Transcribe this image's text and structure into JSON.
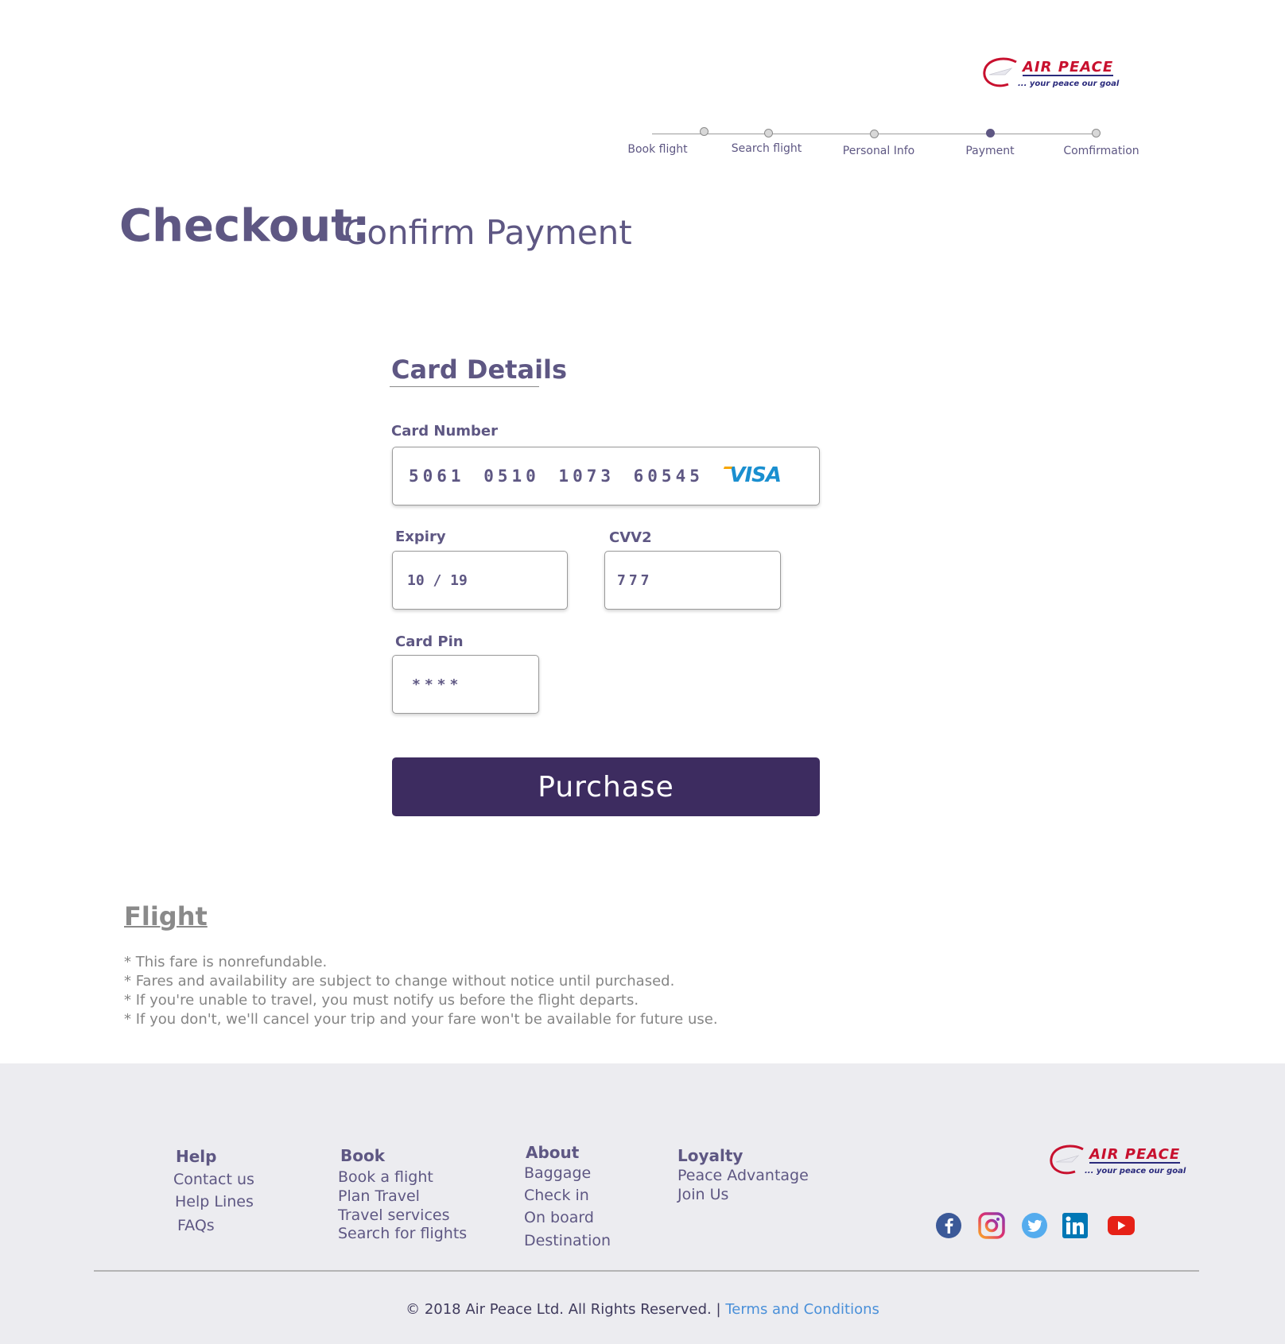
{
  "brand": {
    "name": "AIR PEACE",
    "tagline": "... your peace our goal",
    "colors": {
      "red": "#c8102e",
      "navy": "#2a2a7c",
      "purple": "#5e5783",
      "button": "#3d2c60",
      "link": "#4a90d9"
    }
  },
  "progress": {
    "steps": [
      {
        "label": "Book flight",
        "active": false
      },
      {
        "label": "Search flight",
        "active": false
      },
      {
        "label": "Personal Info",
        "active": false
      },
      {
        "label": "Payment",
        "active": true
      },
      {
        "label": "Comfirmation",
        "active": false
      }
    ]
  },
  "heading": {
    "title": "Checkout:",
    "subtitle": "Confirm Payment"
  },
  "card": {
    "section_title": "Card Details",
    "number_label": "Card Number",
    "number_value": "5061 0510 1073 60545",
    "card_brand": "VISA",
    "expiry_label": "Expiry",
    "expiry_value": "10 / 19",
    "cvv_label": "CVV2",
    "cvv_value": "777",
    "pin_label": "Card Pin",
    "pin_value": "****",
    "purchase_label": "Purchase"
  },
  "flight": {
    "title": "Flight",
    "notes": [
      "* This fare is nonrefundable.",
      "* Fares and availability are subject to change without notice until purchased.",
      "* If you're unable to travel, you must notify us before the flight departs.",
      "* If you don't, we'll cancel your trip and your fare won't be available for future use."
    ]
  },
  "footer": {
    "help": {
      "title": "Help",
      "links": [
        "Contact us",
        "Help Lines",
        "FAQs"
      ]
    },
    "book": {
      "title": "Book",
      "links": [
        "Book a flight",
        "Plan Travel",
        "Travel services",
        "Search for flights"
      ]
    },
    "about": {
      "title": "About",
      "links": [
        "Baggage",
        "Check in",
        "On board",
        "Destination"
      ]
    },
    "loyalty": {
      "title": "Loyalty",
      "links": [
        "Peace Advantage",
        "Join Us"
      ]
    },
    "social_icons": [
      "facebook-icon",
      "instagram-icon",
      "twitter-icon",
      "linkedin-icon",
      "youtube-icon"
    ],
    "copyright": "© 2018 Air Peace Ltd. All Rights Reserved. |",
    "terms": "Terms and Conditions"
  }
}
